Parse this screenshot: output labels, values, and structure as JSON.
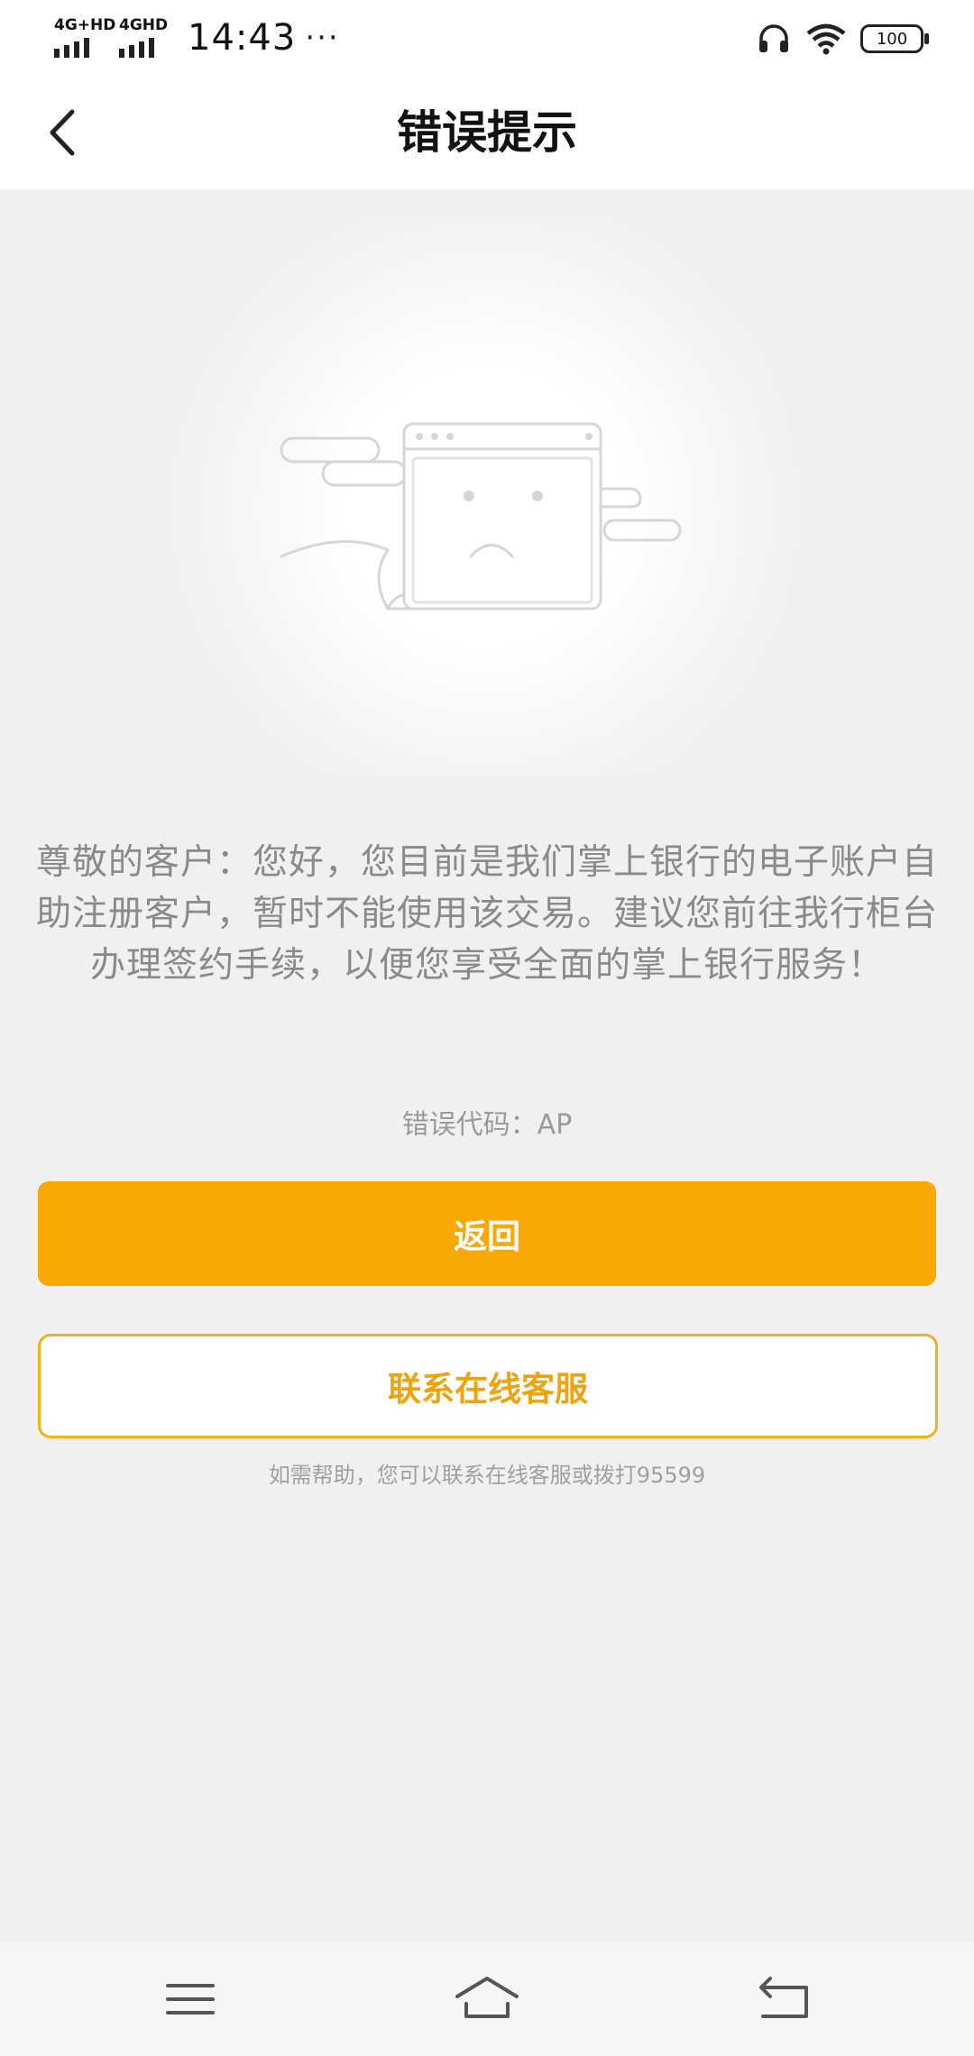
{
  "status_bar": {
    "network1": "4G+HD",
    "network2": "4GHD",
    "time": "14:43",
    "more_icon": "···",
    "battery": "100",
    "icons": [
      "headset-icon",
      "wifi-icon",
      "battery-icon"
    ]
  },
  "nav": {
    "title": "错误提示",
    "back_icon": "chevron-left-icon"
  },
  "illustration": {
    "icon": "sad-browser-window-illustration"
  },
  "message": "尊敬的客户：您好，您目前是我们掌上银行的电子账户自助注册客户，暂时不能使用该交易。建议您前往我行柜台办理签约手续，以便您享受全面的掌上银行服务！",
  "error_code": "错误代码：AP",
  "buttons": {
    "back": "返回",
    "contact": "联系在线客服"
  },
  "help_text": "如需帮助，您可以联系在线客服或拨打95599",
  "colors": {
    "accent": "#f9a806",
    "background": "#f0f0f0",
    "text_secondary": "#8a8a8a"
  },
  "system_nav": {
    "icons": [
      "menu-icon",
      "home-icon",
      "return-icon"
    ]
  }
}
